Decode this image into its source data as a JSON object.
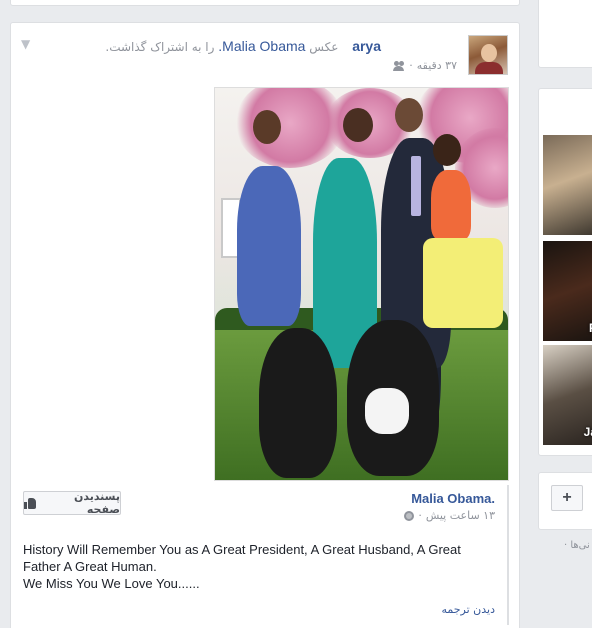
{
  "post": {
    "actor_name": "arya",
    "shared_text_before": "عکس",
    "shared_page": "Malia Obama.",
    "shared_text_after": "را به اشتراک گذاشت.",
    "time": "۳۷ دقیقه",
    "privacy_icon": "friends-icon",
    "menu_icon": "chevron-down-icon"
  },
  "shared": {
    "page_name": "Malia Obama.",
    "time": "۱۳ ساعت پیش",
    "privacy_icon": "globe-icon",
    "like_page_label": "پسندیدن صفحه",
    "text_line1": "History Will Remember You as A Great President, A Great Husband, A Great Father A Great Human.",
    "text_line2": "We Miss You We Love You......",
    "translate_label": "دیدن ترجمه"
  },
  "right_column": {
    "thumbs": [
      {
        "label": ""
      },
      {
        "label": "P"
      },
      {
        "label": "Ja"
      }
    ],
    "plus_label": "+",
    "footer_text": "نی‌ها ·"
  }
}
